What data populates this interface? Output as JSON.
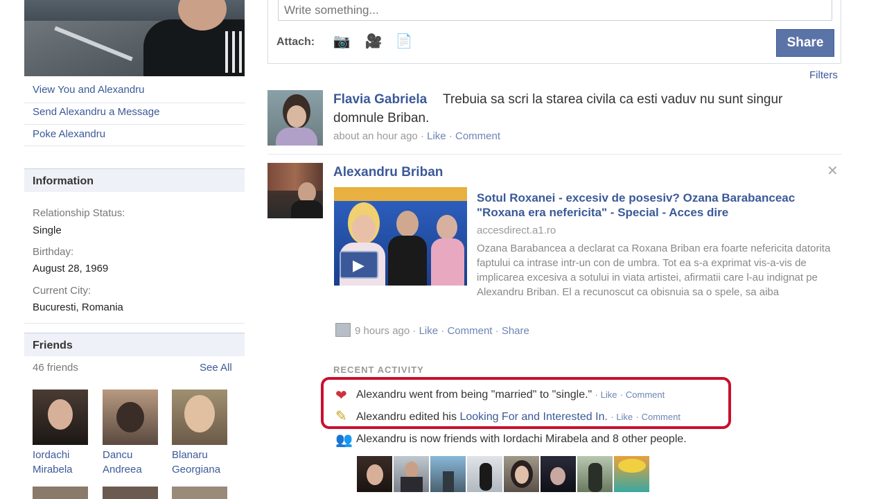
{
  "sidebar": {
    "links": [
      "View You and Alexandru",
      "Send Alexandru a Message",
      "Poke Alexandru"
    ],
    "information": {
      "heading": "Information",
      "relationship_label": "Relationship Status:",
      "relationship_value": "Single",
      "birthday_label": "Birthday:",
      "birthday_value": "August 28, 1969",
      "city_label": "Current City:",
      "city_value": "Bucuresti, Romania"
    },
    "friends": {
      "heading": "Friends",
      "count": "46 friends",
      "see_all": "See All",
      "people": [
        {
          "first": "Iordachi",
          "last": "Mirabela"
        },
        {
          "first": "Dancu",
          "last": "Andreea"
        },
        {
          "first": "Blanaru",
          "last": "Georgiana"
        }
      ]
    }
  },
  "composer": {
    "placeholder": "Write something...",
    "attach_label": "Attach:",
    "share_label": "Share"
  },
  "filters_label": "Filters",
  "posts": [
    {
      "author": "Flavia Gabriela",
      "text": "Trebuia sa scri la starea civila ca esti vaduv nu sunt singur domnule Briban.",
      "time": "about an hour ago",
      "actions": [
        "Like",
        "Comment"
      ]
    },
    {
      "author": "Alexandru Briban",
      "link_title_1": "Sotul Roxanei - excesiv de posesiv? Ozana Barabanceac",
      "link_title_2": "\"Roxana era nefericita\" - Special - Acces dire",
      "link_url": "accesdirect.a1.ro",
      "link_desc": "Ozana Barabancea a declarat ca Roxana Briban era foarte nefericita datorita faptului ca intrase intr-un con de umbra. Tot ea s-a exprimat vis-a-vis de implicarea excesiva a sotului in viata artistei, afirmatii care l-au indignat pe Alexandru Briban. El a recunoscut ca obisnuia sa o spele, sa aiba",
      "time": "9 hours ago",
      "actions": [
        "Like",
        "Comment",
        "Share"
      ]
    }
  ],
  "recent_activity": {
    "heading": "RECENT ACTIVITY",
    "items": [
      {
        "text": "Alexandru went from being \"married\" to \"single.\"",
        "like": "Like",
        "comment": "Comment"
      },
      {
        "text_pre": "Alexandru edited his ",
        "link": "Looking For and Interested In.",
        "like": "Like",
        "comment": "Comment"
      },
      {
        "text": "Alexandru is now friends with Iordachi Mirabela and 8 other people."
      }
    ]
  },
  "colors": {
    "brand": "#3b5998",
    "highlight": "#c8102e",
    "share_button": "#5b74a8"
  }
}
